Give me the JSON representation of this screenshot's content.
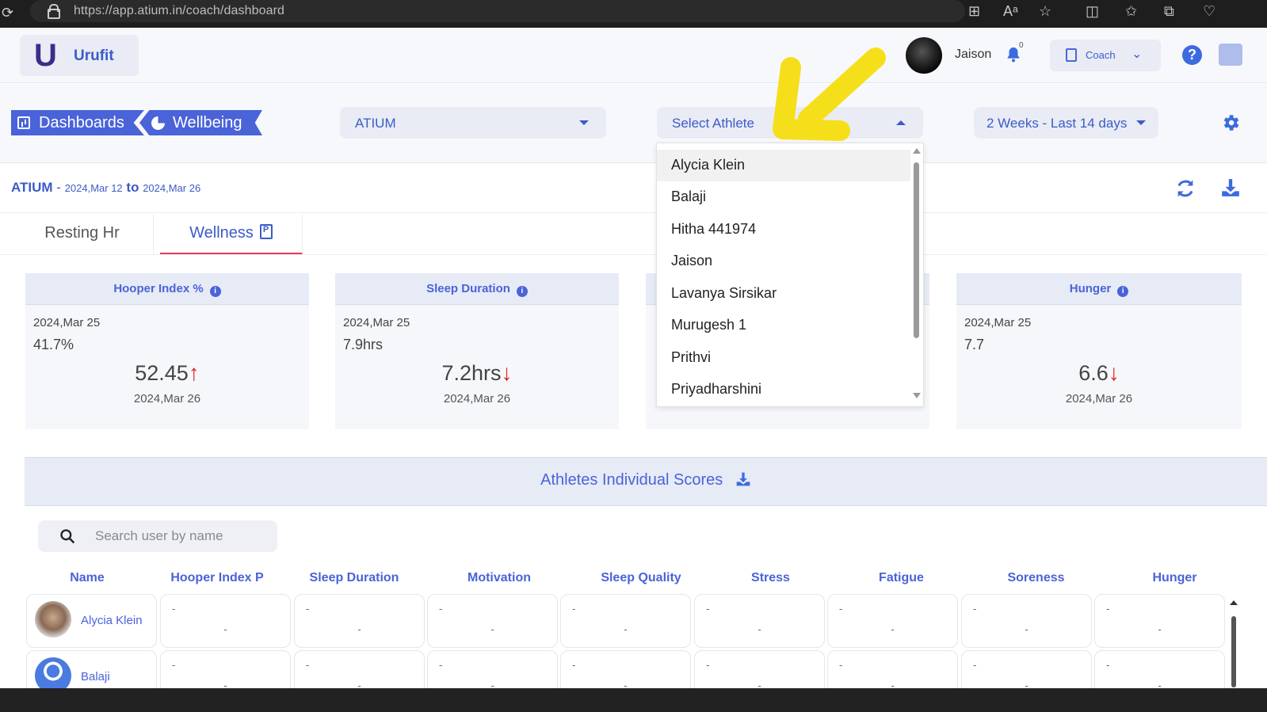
{
  "browser": {
    "url": "https://app.atium.in/coach/dashboard"
  },
  "header": {
    "logo_text": "Urufit",
    "user_name": "Jaison",
    "notification_count": "0",
    "role": "Coach"
  },
  "crumbs": {
    "dashboards": "Dashboards",
    "wellbeing": "Wellbeing"
  },
  "filters": {
    "organization": "ATIUM",
    "athlete_placeholder": "Select Athlete",
    "period": "2 Weeks - Last 14 days"
  },
  "dropdown": {
    "options": [
      "Alycia Klein",
      "Balaji",
      "Hitha 441974",
      "Jaison",
      "Lavanya Sirsikar",
      "Murugesh 1",
      "Prithvi",
      "Priyadharshini"
    ],
    "highlighted": "Alycia Klein"
  },
  "range": {
    "org": "ATIUM",
    "dash": " - ",
    "from": "2024,Mar 12",
    "to_word": "to",
    "to": "2024,Mar 26"
  },
  "tabs": {
    "resting_hr": "Resting Hr",
    "wellness": "Wellness"
  },
  "cards": [
    {
      "title": "Hooper Index %",
      "prev_date": "2024,Mar 25",
      "prev_value": "41.7%",
      "current_value": "52.45",
      "trend": "up",
      "current_date": "2024,Mar 26"
    },
    {
      "title": "Sleep Duration",
      "prev_date": "2024,Mar 25",
      "prev_value": "7.9hrs",
      "current_value": "7.2hrs",
      "trend": "down",
      "current_date": "2024,Mar 26"
    },
    {
      "title": "Hunger",
      "prev_date": "2024,Mar 25",
      "prev_value": "7.7",
      "current_value": "6.6",
      "trend": "down",
      "current_date": "2024,Mar 26"
    }
  ],
  "scores": {
    "title": "Athletes Individual Scores",
    "search_placeholder": "Search user by name",
    "columns": [
      "Name",
      "Hooper Index P",
      "Sleep Duration",
      "Motivation",
      "Sleep Quality",
      "Stress",
      "Fatigue",
      "Soreness",
      "Hunger"
    ],
    "rows": [
      {
        "name": "Alycia Klein",
        "values": [
          "-",
          "-",
          "-",
          "-",
          "-",
          "-",
          "-",
          "-"
        ]
      },
      {
        "name": "Balaji",
        "values": [
          "-",
          "-",
          "-",
          "-",
          "-",
          "-",
          "-",
          "-"
        ]
      }
    ]
  },
  "colors": {
    "accent": "#4a63d8",
    "highlight_arrow": "#f5df1a",
    "trend_arrow": "#e02020"
  }
}
